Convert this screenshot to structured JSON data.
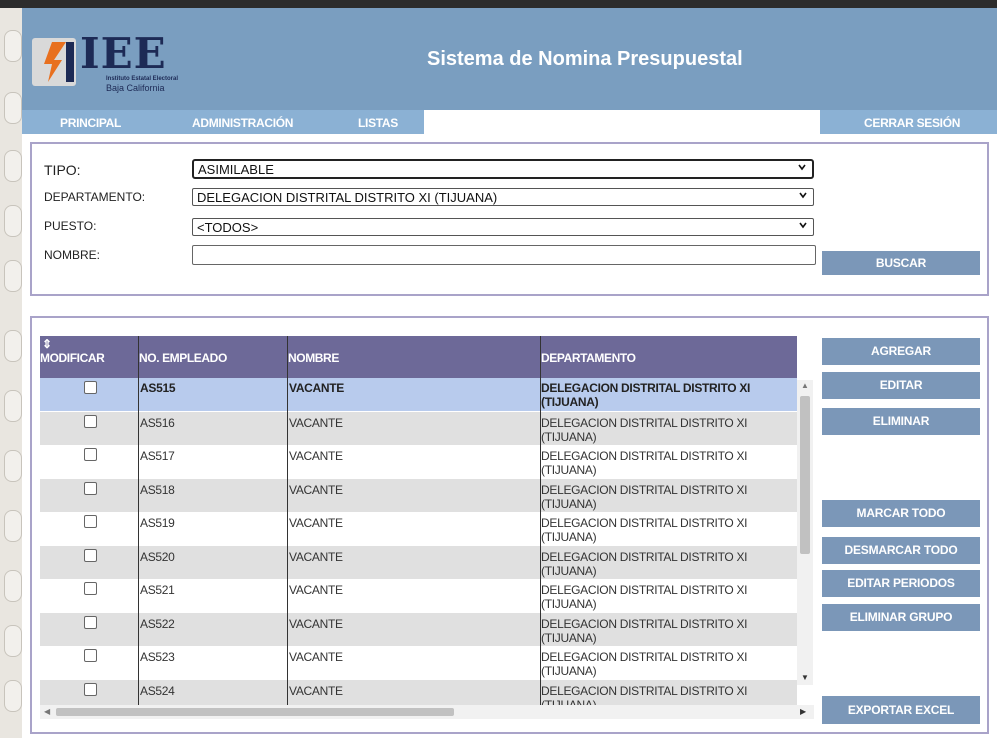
{
  "header": {
    "logo_text": "IEE",
    "logo_subtitle_1": "Instituto Estatal Electoral",
    "logo_subtitle_2": "Baja California",
    "app_title": "Sistema de Nomina Presupuestal"
  },
  "nav": {
    "items": [
      "PRINCIPAL",
      "ADMINISTRACIÓN",
      "LISTAS"
    ],
    "logout": "CERRAR SESIÓN"
  },
  "filters": {
    "tipo_label": "TIPO:",
    "tipo_value": "ASIMILABLE",
    "departamento_label": "DEPARTAMENTO:",
    "departamento_value": "DELEGACION DISTRITAL DISTRITO XI (TIJUANA)",
    "puesto_label": "PUESTO:",
    "puesto_value": "<TODOS>",
    "nombre_label": "NOMBRE:",
    "nombre_value": "",
    "search_button": "BUSCAR"
  },
  "grid": {
    "columns": [
      "MODIFICAR",
      "NO. EMPLEADO",
      "NOMBRE",
      "DEPARTAMENTO"
    ],
    "rows": [
      {
        "employee": "AS515",
        "name": "VACANTE",
        "department": "DELEGACION DISTRITAL DISTRITO XI (TIJUANA)",
        "checked": false,
        "selected": true
      },
      {
        "employee": "AS516",
        "name": "VACANTE",
        "department": "DELEGACION DISTRITAL DISTRITO XI (TIJUANA)",
        "checked": false,
        "selected": false
      },
      {
        "employee": "AS517",
        "name": "VACANTE",
        "department": "DELEGACION DISTRITAL DISTRITO XI (TIJUANA)",
        "checked": false,
        "selected": false
      },
      {
        "employee": "AS518",
        "name": "VACANTE",
        "department": "DELEGACION DISTRITAL DISTRITO XI (TIJUANA)",
        "checked": false,
        "selected": false
      },
      {
        "employee": "AS519",
        "name": "VACANTE",
        "department": "DELEGACION DISTRITAL DISTRITO XI (TIJUANA)",
        "checked": false,
        "selected": false
      },
      {
        "employee": "AS520",
        "name": "VACANTE",
        "department": "DELEGACION DISTRITAL DISTRITO XI (TIJUANA)",
        "checked": false,
        "selected": false
      },
      {
        "employee": "AS521",
        "name": "VACANTE",
        "department": "DELEGACION DISTRITAL DISTRITO XI (TIJUANA)",
        "checked": false,
        "selected": false
      },
      {
        "employee": "AS522",
        "name": "VACANTE",
        "department": "DELEGACION DISTRITAL DISTRITO XI (TIJUANA)",
        "checked": false,
        "selected": false
      },
      {
        "employee": "AS523",
        "name": "VACANTE",
        "department": "DELEGACION DISTRITAL DISTRITO XI (TIJUANA)",
        "checked": false,
        "selected": false
      },
      {
        "employee": "AS524",
        "name": "VACANTE",
        "department": "DELEGACION DISTRITAL DISTRITO XI (TIJUANA)",
        "checked": false,
        "selected": false
      }
    ]
  },
  "actions": {
    "agregar": "AGREGAR",
    "editar": "EDITAR",
    "eliminar": "ELIMINAR",
    "marcar_todo": "MARCAR TODO",
    "desmarcar_todo": "DESMARCAR TODO",
    "editar_periodos": "EDITAR PERIODOS",
    "eliminar_grupo": "ELIMINAR GRUPO",
    "exportar_excel": "EXPORTAR EXCEL"
  },
  "colors": {
    "header_bg": "#7a9ec0",
    "nav_bg": "#8bb1d4",
    "grid_header_bg": "#6d6998",
    "button_bg": "#7b97b8",
    "selected_row_bg": "#b8cbed",
    "alt_row_bg": "#e0e0e0"
  }
}
